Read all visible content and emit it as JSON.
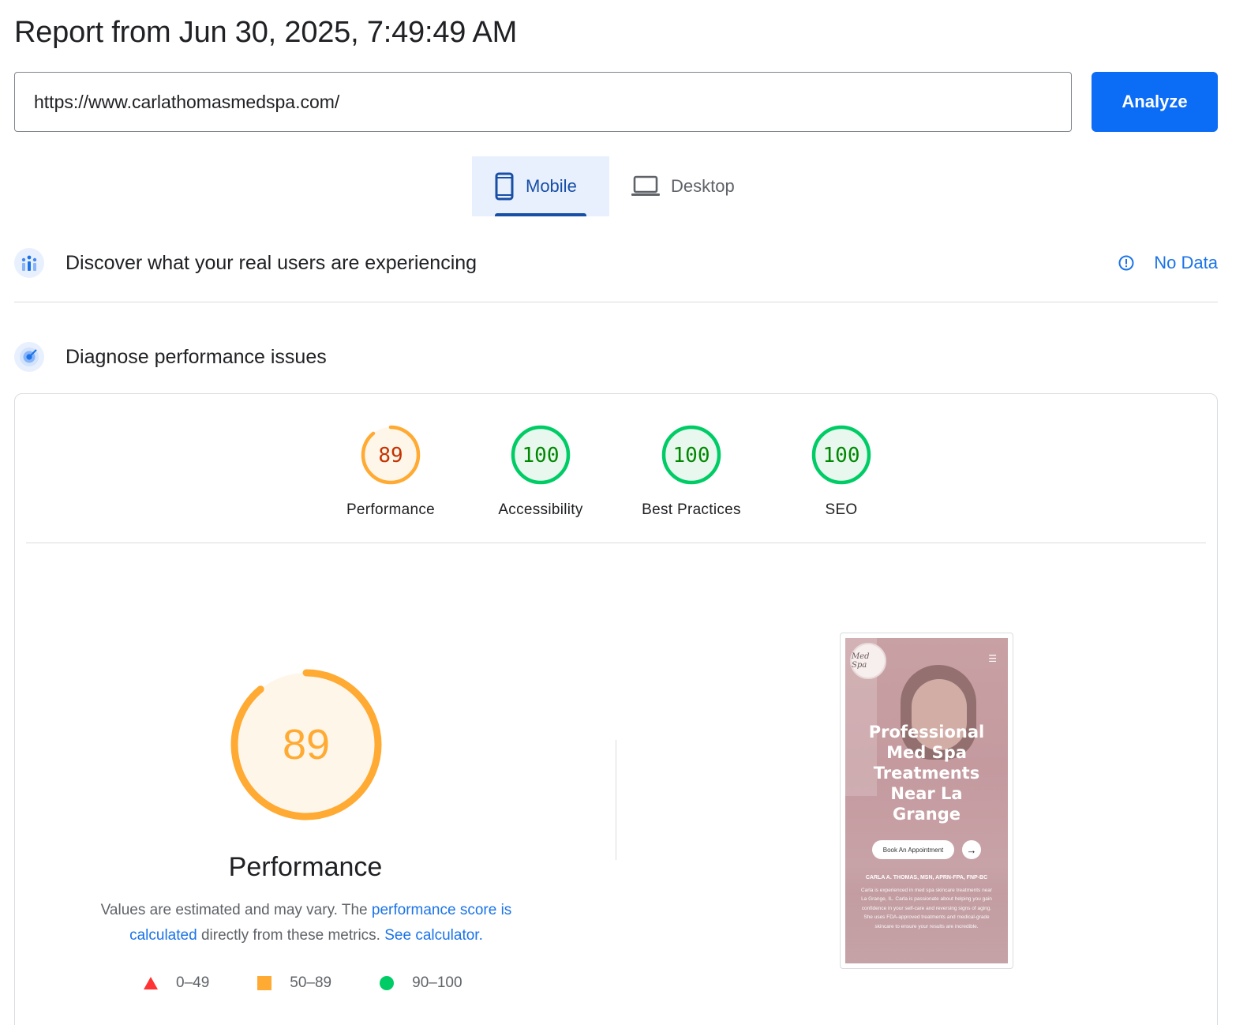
{
  "report": {
    "title": "Report from Jun 30, 2025, 7:49:49 AM"
  },
  "url_bar": {
    "value": "https://www.carlathomasmedspa.com/",
    "analyze_label": "Analyze"
  },
  "tabs": [
    {
      "label": "Mobile",
      "icon": "smartphone-icon",
      "active": true
    },
    {
      "label": "Desktop",
      "icon": "laptop-icon",
      "active": false
    }
  ],
  "field_data": {
    "title": "Discover what your real users are experiencing",
    "status_label": "No Data",
    "status_icon": "info-icon"
  },
  "lab_data": {
    "title": "Diagnose performance issues"
  },
  "scores": [
    {
      "label": "Performance",
      "value": "89",
      "level": "average"
    },
    {
      "label": "Accessibility",
      "value": "100",
      "level": "pass"
    },
    {
      "label": "Best Practices",
      "value": "100",
      "level": "pass"
    },
    {
      "label": "SEO",
      "value": "100",
      "level": "pass"
    }
  ],
  "performance_detail": {
    "score": "89",
    "title": "Performance",
    "desc_prefix": "Values are estimated and may vary. The ",
    "desc_link1": "performance score is calculated",
    "desc_middle": " directly from these metrics. ",
    "desc_link2": "See calculator."
  },
  "legend": [
    {
      "label": "0–49",
      "shape": "triangle",
      "color": "#f33"
    },
    {
      "label": "50–89",
      "shape": "square",
      "color": "#fa3"
    },
    {
      "label": "90–100",
      "shape": "circle",
      "color": "#0c6"
    }
  ],
  "screenshot": {
    "logo_text": "Med Spa",
    "heading": "Professional Med Spa Treatments Near La Grange",
    "button_label": "Book An Appointment",
    "caption": "CARLA A. THOMAS, MSN, APRN-FPA, FNP-BC",
    "body": "Carla is experienced in med spa skincare treatments near La Grange, IL. Carla is passionate about helping you gain confidence in your self-care and reversing signs of aging. She uses FDA-approved treatments and medical-grade skincare to ensure your results are incredible."
  },
  "colors": {
    "accent": "#0b6cf6",
    "tab_active": "#174ea6",
    "link": "#1a73e8",
    "pass": "#0c6",
    "average": "#fa3",
    "fail": "#f33"
  }
}
